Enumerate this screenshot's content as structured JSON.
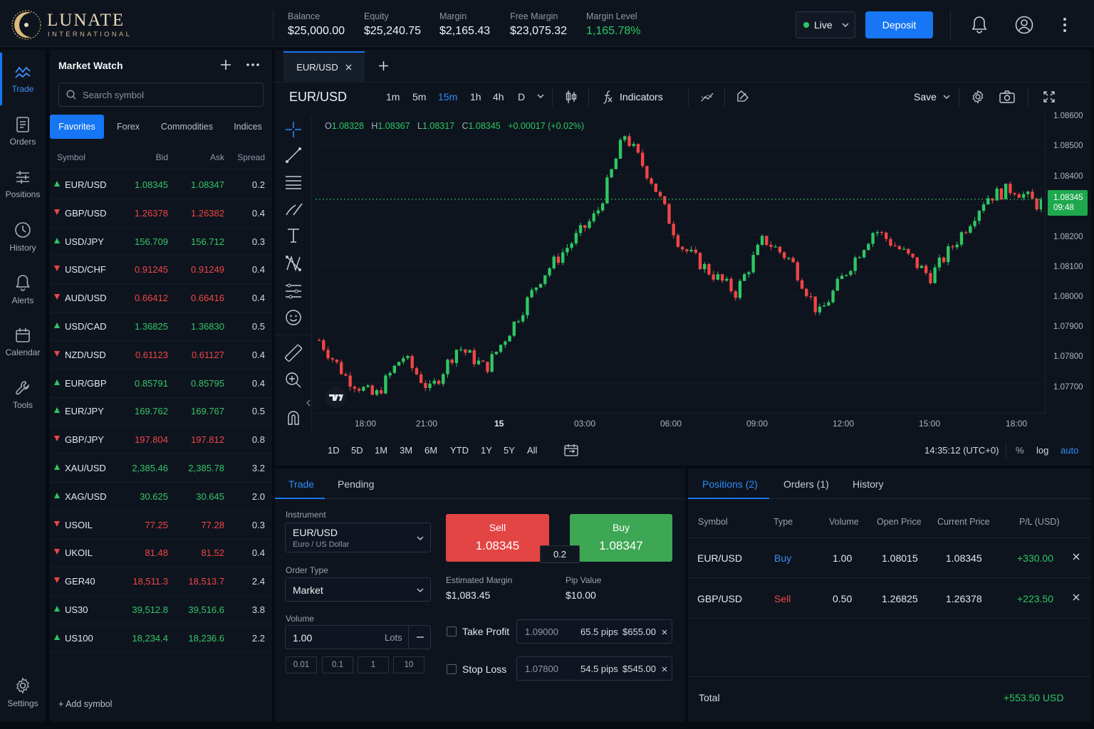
{
  "brand": {
    "name": "LUNATE",
    "sub": "INTERNATIONAL"
  },
  "account": [
    {
      "label": "Balance",
      "value": "$25,000.00"
    },
    {
      "label": "Equity",
      "value": "$25,240.75"
    },
    {
      "label": "Margin",
      "value": "$2,165.43"
    },
    {
      "label": "Free Margin",
      "value": "$23,075.32"
    },
    {
      "label": "Margin Level",
      "value": "1,165.78%"
    }
  ],
  "mode": "Live",
  "deposit_label": "Deposit",
  "nav": [
    {
      "label": "Trade",
      "icon": "trade-icon"
    },
    {
      "label": "Orders",
      "icon": "orders-icon"
    },
    {
      "label": "Positions",
      "icon": "positions-icon"
    },
    {
      "label": "History",
      "icon": "history-icon"
    },
    {
      "label": "Alerts",
      "icon": "bell-icon"
    },
    {
      "label": "Calendar",
      "icon": "calendar-icon"
    },
    {
      "label": "Tools",
      "icon": "wrench-icon"
    },
    {
      "label": "Settings",
      "icon": "gear-icon"
    }
  ],
  "market_watch": {
    "title": "Market Watch",
    "search_placeholder": "Search symbol",
    "tabs": [
      "Favorites",
      "Forex",
      "Commodities",
      "Indices"
    ],
    "columns": [
      "Symbol",
      "Bid",
      "Ask",
      "Spread"
    ],
    "rows": [
      {
        "symbol": "EUR/USD",
        "bid": "1.08345",
        "ask": "1.08347",
        "spread": "0.2",
        "dir": "up"
      },
      {
        "symbol": "GBP/USD",
        "bid": "1.26378",
        "ask": "1.26382",
        "spread": "0.4",
        "dir": "down"
      },
      {
        "symbol": "USD/JPY",
        "bid": "156.709",
        "ask": "156.712",
        "spread": "0.3",
        "dir": "up"
      },
      {
        "symbol": "USD/CHF",
        "bid": "0.91245",
        "ask": "0.91249",
        "spread": "0.4",
        "dir": "down"
      },
      {
        "symbol": "AUD/USD",
        "bid": "0.66412",
        "ask": "0.66416",
        "spread": "0.4",
        "dir": "down"
      },
      {
        "symbol": "USD/CAD",
        "bid": "1.36825",
        "ask": "1.36830",
        "spread": "0.5",
        "dir": "up"
      },
      {
        "symbol": "NZD/USD",
        "bid": "0.61123",
        "ask": "0.61127",
        "spread": "0.4",
        "dir": "down"
      },
      {
        "symbol": "EUR/GBP",
        "bid": "0.85791",
        "ask": "0.85795",
        "spread": "0.4",
        "dir": "up"
      },
      {
        "symbol": "EUR/JPY",
        "bid": "169.762",
        "ask": "169.767",
        "spread": "0.5",
        "dir": "up"
      },
      {
        "symbol": "GBP/JPY",
        "bid": "197.804",
        "ask": "197.812",
        "spread": "0.8",
        "dir": "down"
      },
      {
        "symbol": "XAU/USD",
        "bid": "2,385.46",
        "ask": "2,385.78",
        "spread": "3.2",
        "dir": "up"
      },
      {
        "symbol": "XAG/USD",
        "bid": "30.625",
        "ask": "30.645",
        "spread": "2.0",
        "dir": "up"
      },
      {
        "symbol": "USOIL",
        "bid": "77.25",
        "ask": "77.28",
        "spread": "0.3",
        "dir": "down"
      },
      {
        "symbol": "UKOIL",
        "bid": "81.48",
        "ask": "81.52",
        "spread": "0.4",
        "dir": "down"
      },
      {
        "symbol": "GER40",
        "bid": "18,511.3",
        "ask": "18,513.7",
        "spread": "2.4",
        "dir": "down"
      },
      {
        "symbol": "US30",
        "bid": "39,512.8",
        "ask": "39,516.6",
        "spread": "3.8",
        "dir": "up"
      },
      {
        "symbol": "US100",
        "bid": "18,234.4",
        "ask": "18,236.6",
        "spread": "2.2",
        "dir": "up"
      }
    ],
    "add_symbol": "+  Add symbol"
  },
  "chart": {
    "tab": "EUR/USD",
    "symbol": "EUR/USD",
    "timeframes": [
      "1m",
      "5m",
      "15m",
      "1h",
      "4h",
      "D"
    ],
    "active_timeframe": "15m",
    "indicators_label": "Indicators",
    "save_label": "Save",
    "ohlc": {
      "o": "1.08328",
      "h": "1.08367",
      "l": "1.08317",
      "c": "1.08345",
      "chg": "+0.00017 (+0.02%)"
    },
    "yticks": [
      "1.08600",
      "1.08500",
      "1.08400",
      "1.08200",
      "1.08100",
      "1.08000",
      "1.07900",
      "1.07800",
      "1.07700"
    ],
    "xticks": [
      "18:00",
      "21:00",
      "15",
      "03:00",
      "06:00",
      "09:00",
      "12:00",
      "15:00",
      "18:00"
    ],
    "current_price": "1.08345",
    "countdown": "09:48",
    "ranges": [
      "1D",
      "5D",
      "1M",
      "3M",
      "6M",
      "YTD",
      "1Y",
      "5Y",
      "All"
    ],
    "clock": "14:35:12 (UTC+0)",
    "pct": "%",
    "log": "log",
    "auto": "auto",
    "up_color": "#2ec763",
    "down_color": "#f04646"
  },
  "chart_data": {
    "type": "candlestick",
    "symbol": "EUR/USD",
    "interval": "15m",
    "ylim": [
      1.0767,
      1.0861
    ],
    "last_close": 1.08345,
    "trend_closes": [
      1.079,
      1.0778,
      1.0772,
      1.0785,
      1.0774,
      1.0788,
      1.0781,
      1.0795,
      1.081,
      1.082,
      1.083,
      1.0855,
      1.084,
      1.082,
      1.0812,
      1.0805,
      1.0822,
      1.0815,
      1.0798,
      1.0812,
      1.0825,
      1.0818,
      1.081,
      1.0822,
      1.0835,
      1.0838,
      1.0832
    ]
  },
  "trade": {
    "tabs": [
      "Trade",
      "Pending"
    ],
    "instrument_label": "Instrument",
    "instrument": "EUR/USD",
    "instrument_desc": "Euro / US Dollar",
    "order_type_label": "Order Type",
    "order_type": "Market",
    "volume_label": "Volume",
    "volume": "1.00",
    "volume_unit": "Lots",
    "quick": [
      "0.01",
      "0.1",
      "1",
      "10"
    ],
    "sell_label": "Sell",
    "sell_price": "1.08345",
    "buy_label": "Buy",
    "buy_price": "1.08347",
    "spread": "0.2",
    "est_margin_label": "Estimated Margin",
    "est_margin": "$1,083.45",
    "pip_value_label": "Pip Value",
    "pip_value": "$10.00",
    "take_profit": {
      "label": "Take Profit",
      "price": "1.09000",
      "pips": "65.5 pips",
      "amount": "$655.00"
    },
    "stop_loss": {
      "label": "Stop Loss",
      "price": "1.07800",
      "pips": "54.5 pips",
      "amount": "$545.00"
    }
  },
  "positions": {
    "tabs": [
      "Positions (2)",
      "Orders (1)",
      "History"
    ],
    "columns": [
      "Symbol",
      "Type",
      "Volume",
      "Open Price",
      "Current Price",
      "P/L (USD)"
    ],
    "rows": [
      {
        "symbol": "EUR/USD",
        "type": "Buy",
        "volume": "1.00",
        "open": "1.08015",
        "current": "1.08345",
        "pl": "+330.00"
      },
      {
        "symbol": "GBP/USD",
        "type": "Sell",
        "volume": "0.50",
        "open": "1.26825",
        "current": "1.26378",
        "pl": "+223.50"
      }
    ],
    "total_label": "Total",
    "total": "+553.50 USD"
  }
}
